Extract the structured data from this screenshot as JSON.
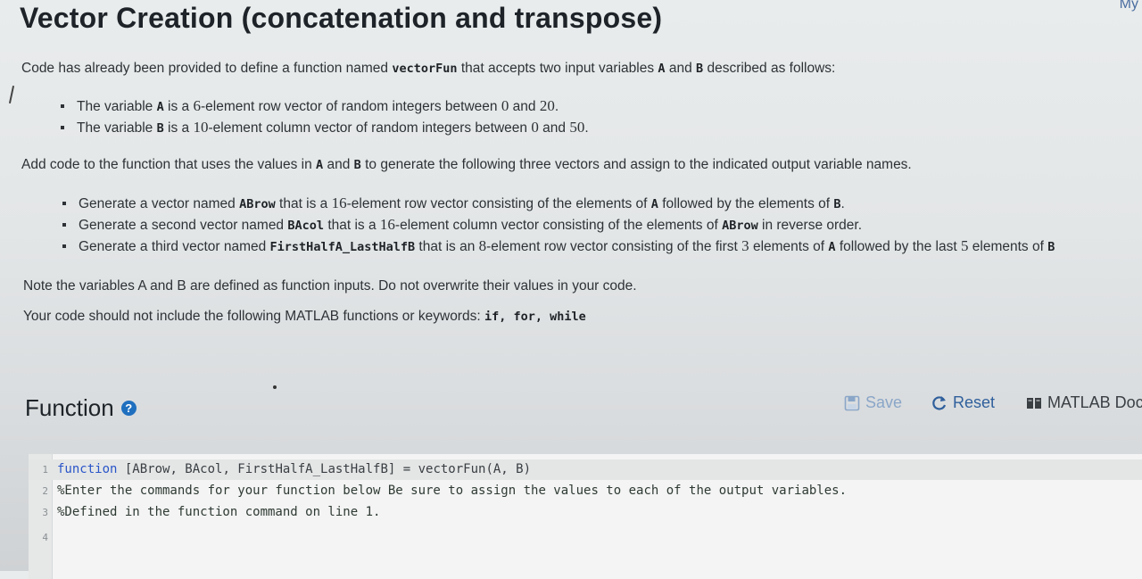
{
  "corner_label": "My",
  "title": "Vector Creation (concatenation and transpose)",
  "intro": {
    "before": "Code has already been provided to define a function named ",
    "function_name": "vectorFun",
    "middle": " that accepts two input variables ",
    "var_a": "A",
    "and": " and ",
    "var_b": "B",
    "after": " described as follows:"
  },
  "inputs": [
    {
      "pre": "The variable ",
      "var": "A",
      "mid": " is a ",
      "num": "6",
      "post": "-element row vector of random integers between ",
      "lo": "0",
      "and": " and ",
      "hi": "20",
      "end": "."
    },
    {
      "pre": "The variable ",
      "var": "B",
      "mid": " is a ",
      "num": "10",
      "post": "-element column vector of random integers between ",
      "lo": "0",
      "and": " and ",
      "hi": "50",
      "end": "."
    }
  ],
  "task": {
    "before": "Add code to the function that uses the values in ",
    "var_a": "A",
    "and": " and ",
    "var_b": "B",
    "after": " to generate the following three vectors and assign to the indicated output variable names."
  },
  "outputs": [
    {
      "pre": "Generate a vector named ",
      "name": "ABrow",
      "mid": " that is a ",
      "num": "16",
      "post": "-element row vector consisting of the elements of ",
      "var1": "A",
      "post2": " followed by the elements of ",
      "var2": "B",
      "end": "."
    },
    {
      "pre": "Generate a second vector named ",
      "name": "BAcol",
      "mid": " that is a ",
      "num": "16",
      "post": "-element column vector consisting of the elements of ",
      "var1": "ABrow",
      "end": " in reverse order."
    },
    {
      "pre": "Generate a third vector named ",
      "name": "FirstHalfA_LastHalfB",
      "mid": " that is an ",
      "num": "8",
      "post": "-element row vector consisting of the first ",
      "num2": "3",
      "post2": " elements of ",
      "var1": "A",
      "post3": " followed by the last ",
      "num3": "5",
      "post4": " elements of ",
      "var2": "B"
    }
  ],
  "note": "Note the variables A and B are defined as function inputs.  Do not overwrite their values in your code.",
  "restriction": {
    "text": "Your code should not include the following MATLAB functions or keywords: ",
    "keywords": "if, for, while"
  },
  "function_section": {
    "heading": "Function",
    "save_label": "Save",
    "reset_label": "Reset",
    "docs_label": "MATLAB Docu"
  },
  "editor": {
    "lines": [
      {
        "no": "1",
        "keyword": "function",
        "rest": " [ABrow, BAcol, FirstHalfA_LastHalfB] = vectorFun(A, B)"
      },
      {
        "no": "2",
        "text": "%Enter the commands for your function below Be sure to assign the values to each of the output variables."
      },
      {
        "no": "3",
        "text": "%Defined in the function command on line 1."
      },
      {
        "no": "4",
        "text": ""
      }
    ]
  },
  "colors": {
    "background": "#e3e6e7",
    "keyword_blue": "#2a55c8",
    "help_icon": "#1f6fbf",
    "reset_blue": "#2f5f9c",
    "save_disabled": "#8aa6c8"
  },
  "icons": {
    "help": "question-circle-icon",
    "save": "floppy-disk-icon",
    "reset": "refresh-icon",
    "docs": "book-icon"
  }
}
